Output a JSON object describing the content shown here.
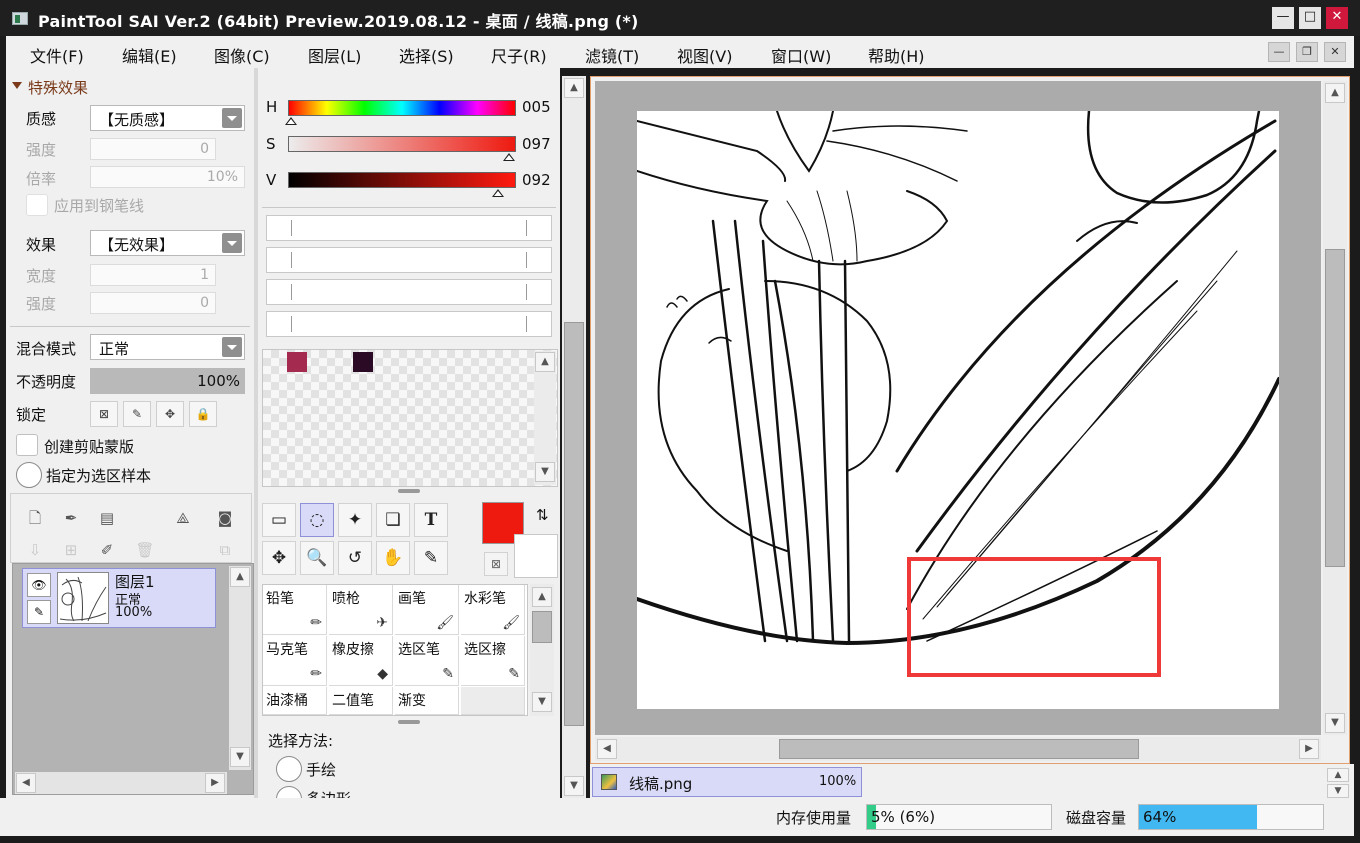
{
  "window": {
    "title": "PaintTool SAI Ver.2 (64bit) Preview.2019.08.12 - 桌面 / 线稿.png (*)",
    "minimize": "—",
    "maximize": "□",
    "close": "✕"
  },
  "menubar": {
    "items": [
      "文件(F)",
      "编辑(E)",
      "图像(C)",
      "图层(L)",
      "选择(S)",
      "尺子(R)",
      "滤镜(T)",
      "视图(V)",
      "窗口(W)",
      "帮助(H)"
    ],
    "mdi_minimize": "—",
    "mdi_restore": "❐",
    "mdi_close": "✕"
  },
  "effects": {
    "section_title": "特殊效果",
    "texture_label": "质感",
    "texture_value": "【无质感】",
    "strength_label": "强度",
    "strength_value": "0",
    "scale_label": "倍率",
    "scale_value": "10%",
    "apply_pen_label": "应用到钢笔线",
    "effect_label": "效果",
    "effect_value": "【无效果】",
    "width_label": "宽度",
    "width_value": "1",
    "effect_strength_label": "强度",
    "effect_strength_value": "0"
  },
  "layer_props": {
    "blend_label": "混合模式",
    "blend_value": "正常",
    "opacity_label": "不透明度",
    "opacity_value": "100%",
    "opacity_fraction": 1.0,
    "lock_label": "锁定",
    "clipping_label": "创建剪贴蒙版",
    "selection_source_label": "指定为选区样本"
  },
  "layers": [
    {
      "name": "图层1",
      "mode": "正常",
      "opacity": "100%"
    }
  ],
  "color": {
    "h_label": "H",
    "h_value": "005",
    "h_fraction": 0.014,
    "s_label": "S",
    "s_value": "097",
    "s_fraction": 0.97,
    "v_label": "V",
    "v_value": "092",
    "v_fraction": 0.92,
    "primary": "#ee1a10",
    "secondary": "#ffffff",
    "swatches": [
      "#a52a4f",
      "#2a0a24"
    ]
  },
  "tools": {
    "row1": [
      "▭",
      "◌",
      "✦",
      "❏",
      "T"
    ],
    "row2": [
      "✥",
      "🔍",
      "↺",
      "✋",
      "✎"
    ]
  },
  "brushes": [
    {
      "name": "铅笔",
      "icon": "✏"
    },
    {
      "name": "喷枪",
      "icon": "✈"
    },
    {
      "name": "画笔",
      "icon": "🖌"
    },
    {
      "name": "水彩笔",
      "icon": "🖌"
    },
    {
      "name": "马克笔",
      "icon": "✏"
    },
    {
      "name": "橡皮擦",
      "icon": "◆"
    },
    {
      "name": "选区笔",
      "icon": "✎"
    },
    {
      "name": "选区擦",
      "icon": "✎"
    },
    {
      "name": "油漆桶",
      "icon": ""
    },
    {
      "name": "二值笔",
      "icon": ""
    },
    {
      "name": "渐变",
      "icon": ""
    }
  ],
  "tool_options": {
    "method_label": "选择方法:",
    "freehand": "手绘",
    "polygon": "多边形"
  },
  "document": {
    "tab_name": "线稿.png",
    "zoom": "100%"
  },
  "status": {
    "memory_label": "内存使用量",
    "memory_value": "5% (6%)",
    "memory_fraction": 0.05,
    "disk_label": "磁盘容量",
    "disk_value": "64%",
    "disk_fraction": 0.64
  },
  "colors": {
    "selection_blue": "#d9daf7",
    "disk_bar": "#41b8f2",
    "memory_bar": "#33cc88",
    "highlight_box": "#ef3838"
  }
}
